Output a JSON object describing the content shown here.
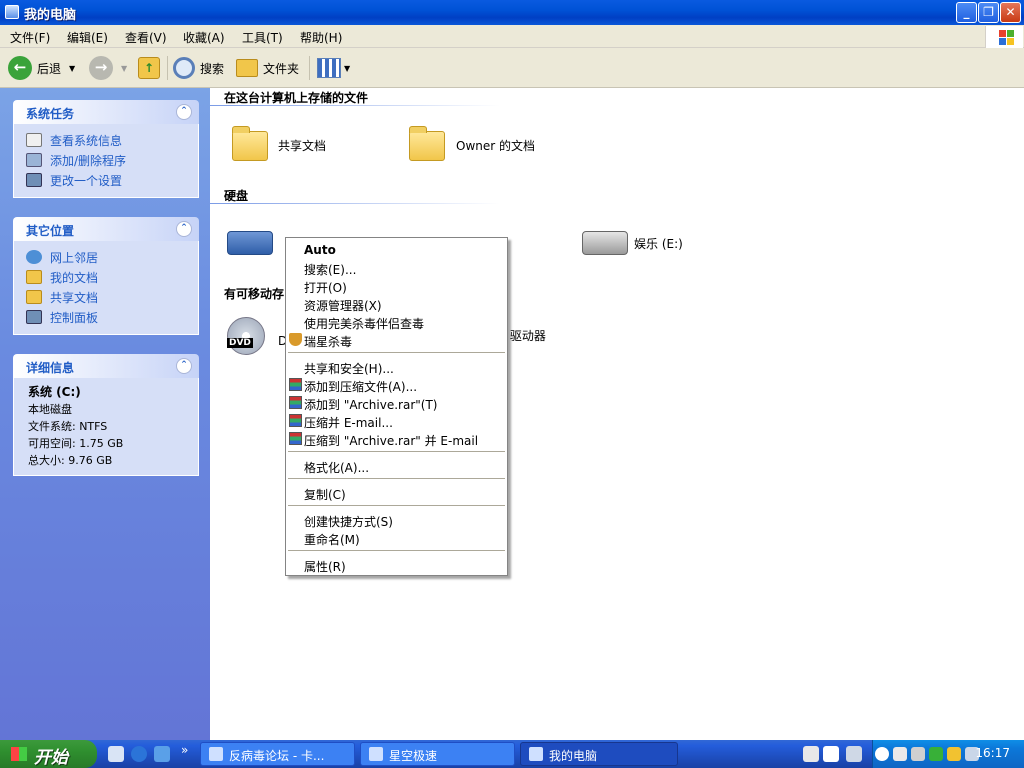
{
  "window": {
    "title": "我的电脑",
    "min": "_",
    "max": "❐",
    "close": "✕"
  },
  "menubar": [
    "文件(F)",
    "编辑(E)",
    "查看(V)",
    "收藏(A)",
    "工具(T)",
    "帮助(H)"
  ],
  "toolbar": {
    "back": "后退",
    "search": "搜索",
    "folders": "文件夹"
  },
  "sidebar": {
    "system_tasks": {
      "title": "系统任务",
      "items": [
        "查看系统信息",
        "添加/删除程序",
        "更改一个设置"
      ]
    },
    "other_places": {
      "title": "其它位置",
      "items": [
        "网上邻居",
        "我的文档",
        "共享文档",
        "控制面板"
      ]
    },
    "details": {
      "title": "详细信息",
      "name": "系统 (C:)",
      "type": "本地磁盘",
      "filesystem": "文件系统: NTFS",
      "free": "可用空间: 1.75 GB",
      "total": "总大小: 9.76 GB"
    }
  },
  "content": {
    "group_files": "在这台计算机上存储的文件",
    "shared_docs": "共享文档",
    "owner_docs": "Owner 的文档",
    "group_hdd": "硬盘",
    "drive_e": "娱乐 (E:)",
    "group_removable": "有可移动存",
    "dvd_partial": "D",
    "drive_label_partial": "/ 驱动器",
    "dvd_badge": "DVD"
  },
  "context_menu": {
    "items": [
      "Auto",
      "搜索(E)...",
      "打开(O)",
      "资源管理器(X)",
      "使用完美杀毒伴侣查毒",
      "瑞星杀毒",
      "共享和安全(H)...",
      "添加到压缩文件(A)...",
      "添加到 \"Archive.rar\"(T)",
      "压缩并 E-mail...",
      "压缩到 \"Archive.rar\" 并 E-mail",
      "格式化(A)...",
      "复制(C)",
      "创建快捷方式(S)",
      "重命名(M)",
      "属性(R)"
    ]
  },
  "taskbar": {
    "start": "开始",
    "chevron": "»",
    "tasks": [
      "反病毒论坛 - 卡...",
      "星空极速",
      "我的电脑"
    ],
    "clock": "16:17"
  }
}
